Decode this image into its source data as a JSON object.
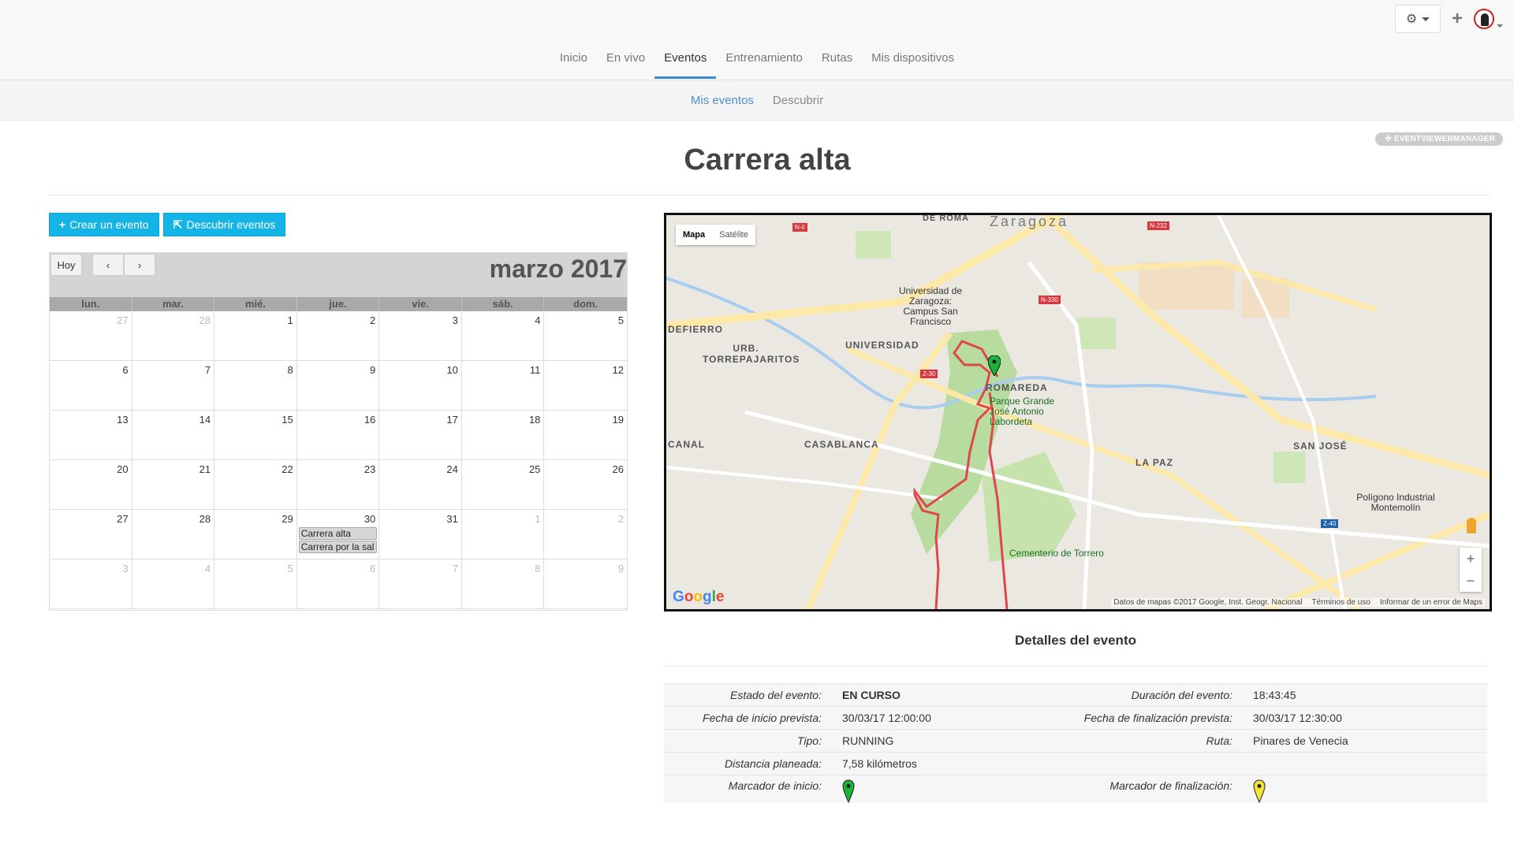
{
  "header": {
    "nav": [
      "Inicio",
      "En vivo",
      "Eventos",
      "Entrenamiento",
      "Rutas",
      "Mis dispositivos"
    ],
    "active_nav": "Eventos",
    "subnav": [
      "Mis eventos",
      "Descubrir"
    ]
  },
  "badge": "EVENTVIEWERMANAGER",
  "page_title": "Carrera alta",
  "buttons": {
    "create": "Crear un evento",
    "discover": "Descubrir eventos"
  },
  "calendar": {
    "today_label": "Hoy",
    "month": "marzo 2017",
    "days_of_week": [
      "lun.",
      "mar.",
      "mié.",
      "jue.",
      "vie.",
      "sáb.",
      "dom."
    ],
    "days": [
      "27",
      "28",
      "1",
      "2",
      "3",
      "4",
      "5",
      "6",
      "7",
      "8",
      "9",
      "10",
      "11",
      "12",
      "13",
      "14",
      "15",
      "16",
      "17",
      "18",
      "19",
      "20",
      "21",
      "22",
      "23",
      "24",
      "25",
      "26",
      "27",
      "28",
      "29",
      "30",
      "31",
      "1",
      "2",
      "3",
      "4",
      "5",
      "6",
      "7",
      "8",
      "9"
    ],
    "other_month_indexes": [
      0,
      1,
      33,
      34,
      35,
      36,
      37,
      38,
      39,
      40,
      41
    ],
    "events": [
      {
        "cell": 31,
        "label": "Carrera alta"
      },
      {
        "cell": 31,
        "label": "Carrera por la sal"
      }
    ]
  },
  "map": {
    "type_buttons": [
      "Mapa",
      "Satélite"
    ],
    "logo": "Google",
    "footer": [
      "Datos de mapas ©2017 Google, Inst. Geogr. Nacional",
      "Términos de uso",
      "Informar de un error de Maps"
    ],
    "labels": [
      "Zaragoza",
      "DE ROMA",
      "Universidad de Zaragoza: Campus San Francisco",
      "UNIVERSIDAD",
      "URB. TORREPAJARITOS",
      "ROMAREDA",
      "Parque Grande José Antonio Labordeta",
      "CASABLANCA",
      "LA PAZ",
      "SAN JOSÉ",
      "Cementerio de Torrero",
      "Polígono Industrial Montemolín",
      "DEFIERRO",
      "CANAL"
    ],
    "road_badges": [
      "N-II",
      "N-232",
      "N-330",
      "Z-30",
      "Z-40"
    ]
  },
  "details": {
    "title": "Detalles del evento",
    "rows": [
      {
        "l1": "Estado del evento:",
        "v1": "EN CURSO",
        "l2": "Duración del evento:",
        "v2": "18:43:45"
      },
      {
        "l1": "Fecha de inicio prevista:",
        "v1": "30/03/17 12:00:00",
        "l2": "Fecha de finalización prevista:",
        "v2": "30/03/17 12:30:00"
      },
      {
        "l1": "Tipo:",
        "v1": "RUNNING",
        "l2": "Ruta:",
        "v2": "Pinares de Venecia"
      },
      {
        "l1": "Distancia planeada:",
        "v1": "7,58 kilómetros",
        "l2": "",
        "v2": ""
      },
      {
        "l1": "Marcador de inicio:",
        "v1": "",
        "l2": "Marcador de finalización:",
        "v2": ""
      }
    ],
    "start_marker_color": "#1db33a",
    "end_marker_color": "#f3e23a"
  },
  "colors": {
    "accent": "#3b8ed6",
    "button": "#14b4e6",
    "route": "#e0474c"
  }
}
